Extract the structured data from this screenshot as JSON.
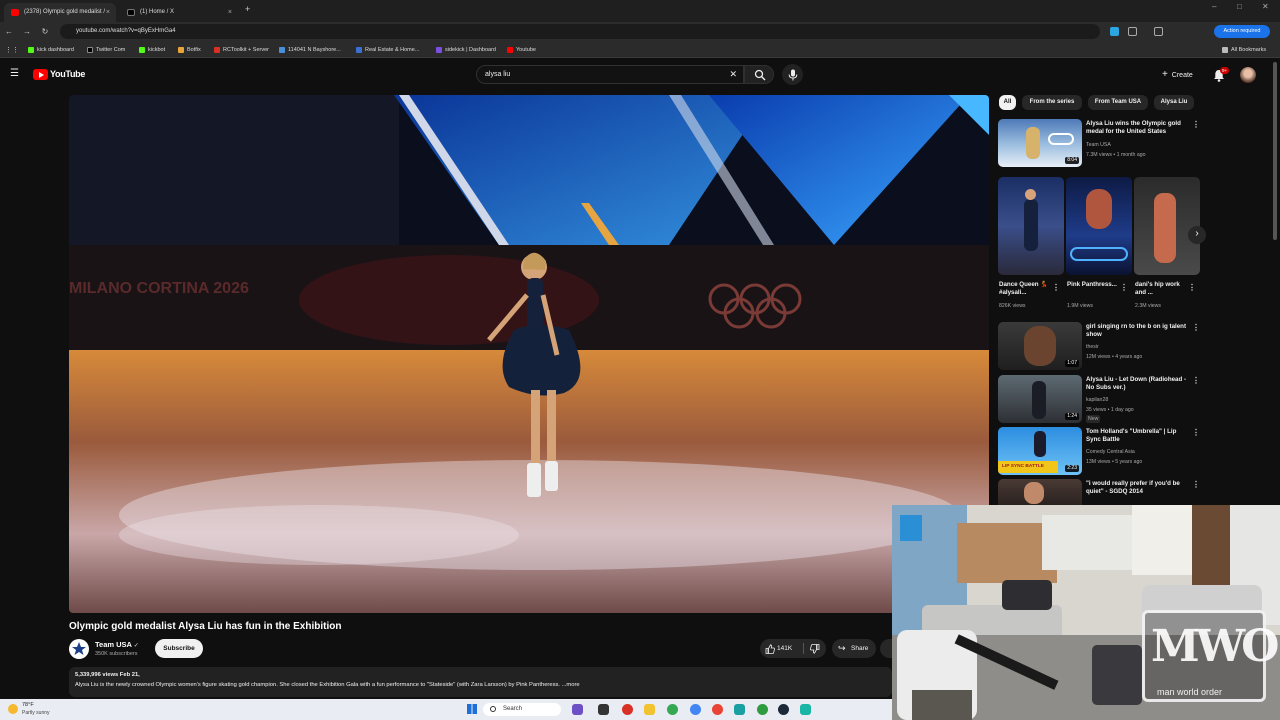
{
  "browser": {
    "tabs": [
      {
        "title": "(2378) Olympic gold medalist /",
        "close": "×"
      },
      {
        "title": "(1) Home / X",
        "close": "×"
      }
    ],
    "new_tab": "+",
    "url": "youtube.com/watch?v=qByExHmGa4",
    "action_required": "Action required",
    "bookmarks": [
      "kick dashboard",
      "Twitter Com",
      "kickbot",
      "Botfix",
      "RCToolkit + Server",
      "114041 N Bayshore...",
      "Real Estate & Home...",
      "sidekick | Dashboard",
      "Youtube"
    ],
    "all_bookmarks": "All Bookmarks",
    "nav": {
      "back": "←",
      "forward": "→",
      "reload": "↻"
    }
  },
  "youtube": {
    "logo": "YouTube",
    "search_query": "alysa liu",
    "create_label": "Create",
    "notification_count": "9+"
  },
  "video": {
    "title": "Olympic gold medalist Alysa Liu has fun in the Exhibition",
    "overlay_text": "MILANO CORTINA 2026",
    "channel": "Team USA",
    "subscribers": "350K subscribers",
    "subscribe_label": "Subscribe",
    "likes": "141K",
    "share_label": "Share",
    "views_date": "5,339,996 views  Feb 21,",
    "description": "Alysa Liu is the newly crowned Olympic women's figure skating gold champion. She closed the Exhibition Gala with a fun performance to \"Stateside\" (with Zara Larsson) by Pink Pantheress. ...more"
  },
  "sidebar": {
    "chips": [
      "All",
      "From the series",
      "From Team USA",
      "Alysa Liu"
    ],
    "first": {
      "title": "Alysa Liu wins the Olympic gold medal for the United States",
      "channel": "Team USA",
      "meta": "7.3M views • 1 month ago",
      "duration": "8:04"
    },
    "shorts": [
      {
        "title": "Dance Queen 💃 #alysali...",
        "views": "826K views"
      },
      {
        "title": "Pink Panthress...",
        "views": "1.9M views"
      },
      {
        "title": "dani's hip work and ...",
        "views": "2.3M views"
      }
    ],
    "videos": [
      {
        "title": "girl singing rn to the b on ig talent show",
        "channel": "thesir",
        "meta": "12M views • 4 years ago",
        "duration": "1:07",
        "badge": ""
      },
      {
        "title": "Alysa Liu - Let Down (Radiohead - No Subs ver.)",
        "channel": "kapilan28",
        "meta": "35 views • 1 day ago",
        "duration": "1:24",
        "badge": "New"
      },
      {
        "title": "Tom Holland's \"Umbrella\" | Lip Sync Battle",
        "channel": "Comedy Central Asia",
        "meta": "13M views • 5 years ago",
        "duration": "2:23",
        "badge": ""
      },
      {
        "title": "\"i would really prefer if you'd be quiet\" - SGDQ 2014",
        "channel": "",
        "meta": "",
        "duration": "",
        "badge": ""
      }
    ],
    "thumb_banner": "LIP SYNC BATTLE",
    "shorts_next": "›"
  },
  "webcam": {
    "watermark_letters": "MWO",
    "watermark_caption": "man world order"
  },
  "taskbar": {
    "weather_temp": "78°F",
    "weather_desc": "Partly sunny",
    "search": "Search"
  },
  "colors": {
    "yt_red": "#ff0000",
    "bg": "#0f0f0f",
    "action_required": "#1a73e8"
  }
}
